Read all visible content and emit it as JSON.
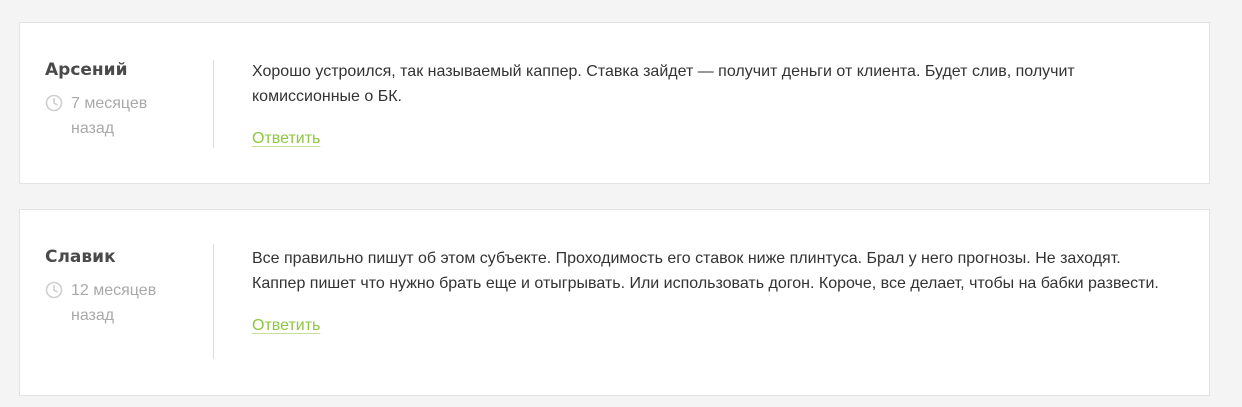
{
  "comments": [
    {
      "author": "Арсений",
      "date": "7 месяцев назад",
      "text": "Хорошо устроился, так называемый каппер. Ставка зайдет — получит деньги от клиента. Будет слив, получит комиссионные о БК.",
      "reply_label": "Ответить"
    },
    {
      "author": "Славик",
      "date": "12 месяцев назад",
      "text": "Все правильно пишут об этом субъекте. Проходимость его ставок ниже плинтуса. Брал у него прогнозы. Не заходят. Каппер пишет что нужно брать еще и отыгрывать. Или использовать догон. Короче, все делает, чтобы на бабки развести.",
      "reply_label": "Ответить"
    }
  ],
  "icons": {
    "date": "clock-icon"
  },
  "colors": {
    "accent": "#8dc63f",
    "text": "#333333",
    "muted": "#a9a9a9",
    "background": "#f4f4f4"
  }
}
